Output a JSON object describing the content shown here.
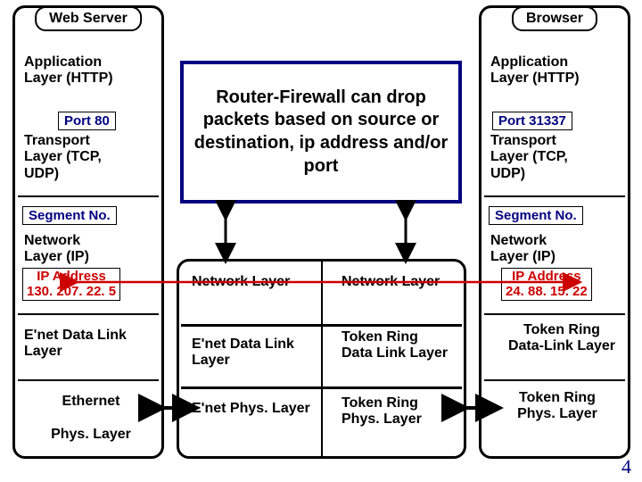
{
  "left": {
    "title": "Web Server",
    "app": "Application Layer (HTTP)",
    "port": "Port 80",
    "trans": "Transport Layer (TCP, UDP)",
    "seg": "Segment No.",
    "net": "Network Layer (IP)",
    "ip_lbl": "IP Address",
    "ip": "130. 207. 22. 5",
    "dlink": "E'net Data Link Layer",
    "phys1": "Ethernet",
    "phys2": "Phys. Layer"
  },
  "right": {
    "title": "Browser",
    "app": "Application Layer (HTTP)",
    "port": "Port 31337",
    "trans": "Transport Layer (TCP, UDP)",
    "seg": "Segment No.",
    "net": "Network Layer (IP)",
    "ip_lbl": "IP Address",
    "ip": "24. 88. 15. 22",
    "dlink": "Token Ring",
    "dlink2": "Data-Link Layer",
    "phys1": "Token Ring",
    "phys2": "Phys. Layer"
  },
  "mid": {
    "fw": "Router-Firewall can drop packets based on source or destination, ip address and/or port",
    "netL": "Network Layer",
    "netR": "Network Layer",
    "dlinkL": "E'net Data Link Layer",
    "dlinkR1": "Token Ring",
    "dlinkR2": "Data Link Layer",
    "physL": "E'net Phys. Layer",
    "physR1": "Token Ring",
    "physR2": "Phys. Layer"
  },
  "page": "4"
}
